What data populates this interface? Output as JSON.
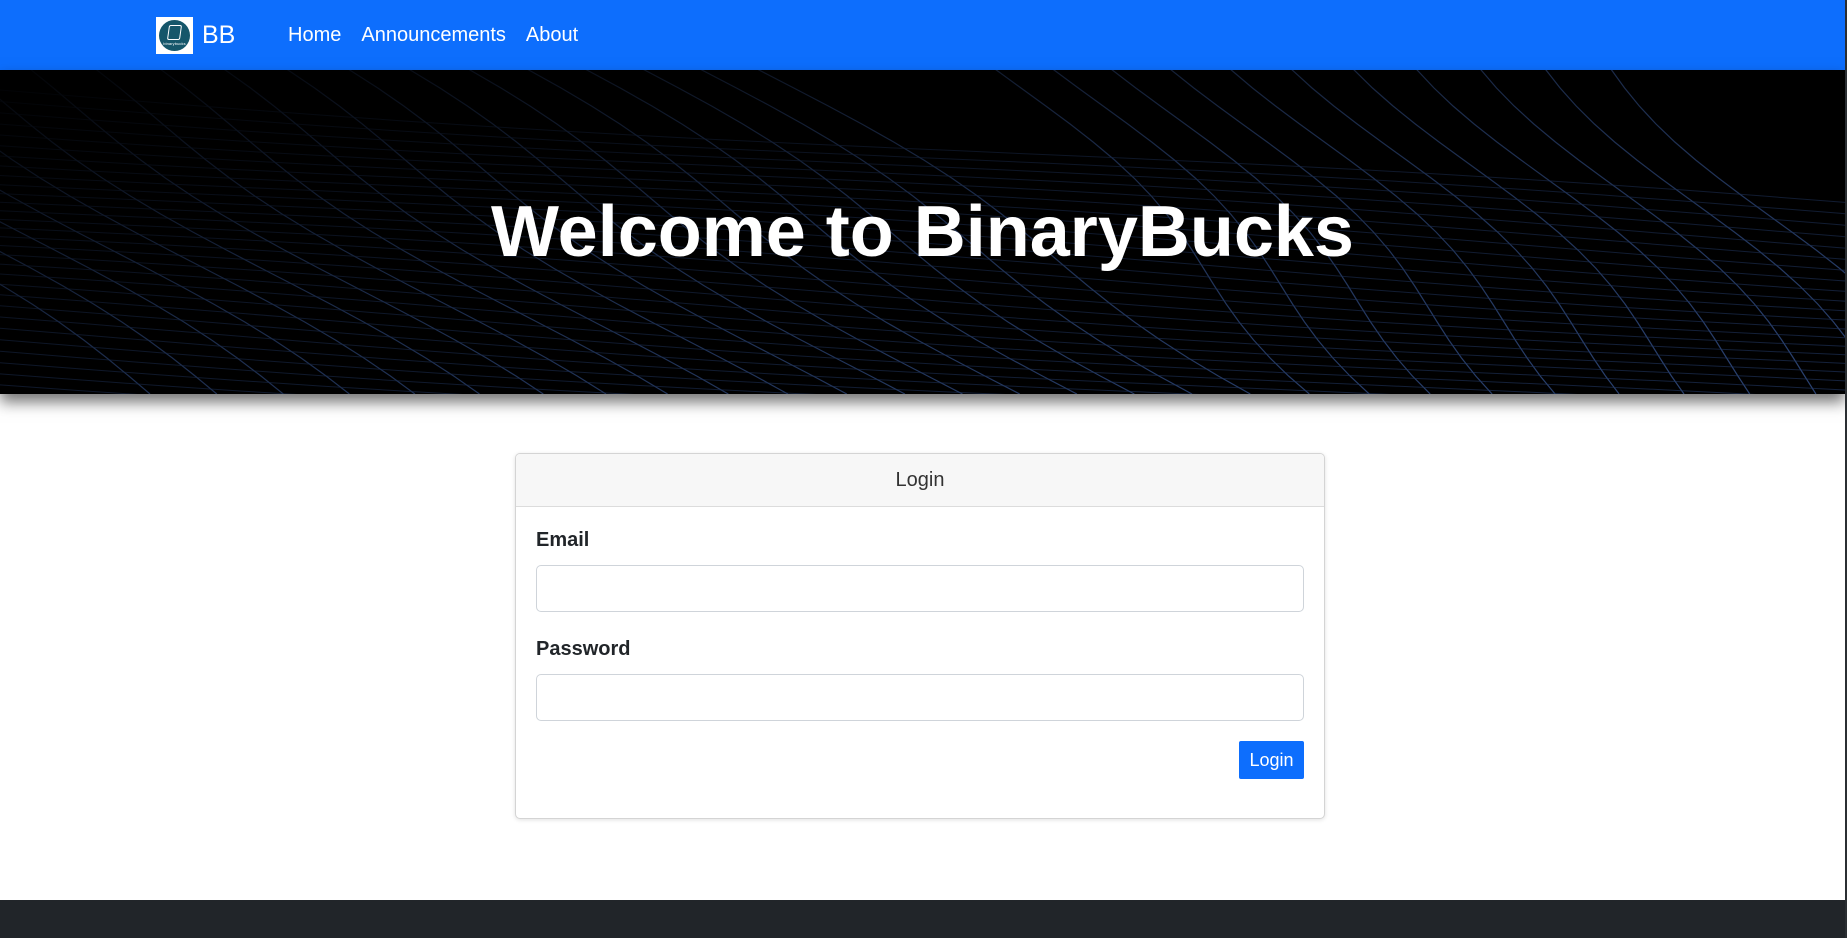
{
  "navbar": {
    "brand": {
      "logo_text": "binarybucks",
      "name": "BB"
    },
    "links": [
      "Home",
      "Announcements",
      "About"
    ]
  },
  "hero": {
    "title": "Welcome to BinaryBucks"
  },
  "login_card": {
    "header": "Login",
    "email": {
      "label": "Email",
      "value": "",
      "placeholder": ""
    },
    "password": {
      "label": "Password",
      "value": "",
      "placeholder": ""
    },
    "submit_label": "Login"
  },
  "colors": {
    "primary": "#0d6efd",
    "hero_background": "#000000",
    "hero_lines": "#3a5a9a",
    "footer": "#212529",
    "logo": "#15566a"
  },
  "icons": {
    "brand_logo": "binarybucks-logo-icon"
  }
}
